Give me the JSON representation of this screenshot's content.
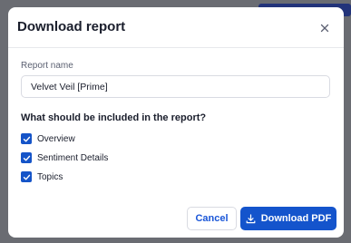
{
  "modal": {
    "title": "Download report",
    "report_name_label": "Report name",
    "report_name_value": "Velvet Veil [Prime]",
    "question": "What should be included in the report?",
    "options": [
      {
        "label": "Overview",
        "checked": true
      },
      {
        "label": "Sentiment Details",
        "checked": true
      },
      {
        "label": "Topics",
        "checked": true
      }
    ],
    "cancel_label": "Cancel",
    "download_label": "Download PDF"
  },
  "icons": {
    "close": "close-icon",
    "checkbox": "checkmark-icon",
    "download": "download-icon"
  },
  "colors": {
    "primary": "#1454cc",
    "overlay": "#5f6167"
  }
}
